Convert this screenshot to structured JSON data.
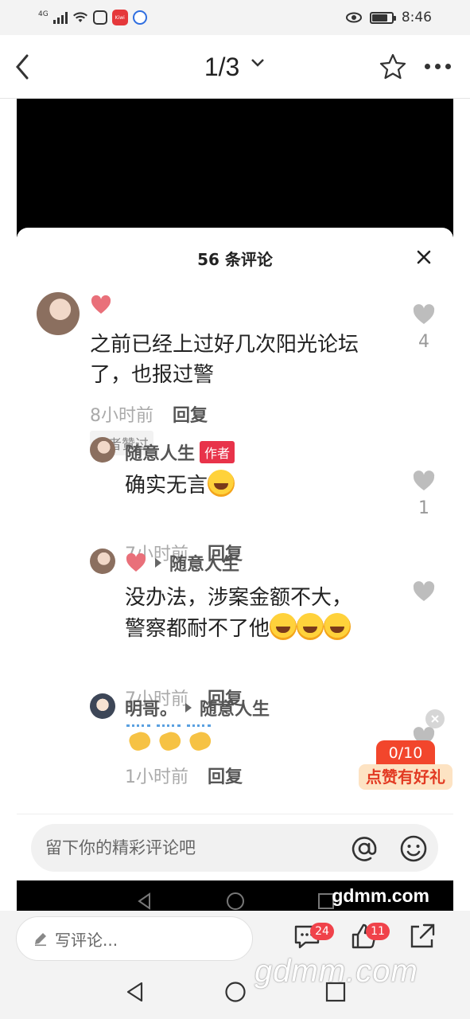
{
  "status_bar": {
    "network": "4G",
    "app_badge": "Kiwi",
    "time": "8:46"
  },
  "nav": {
    "page_indicator": "1/3"
  },
  "comments_sheet": {
    "title": "56 条评论",
    "comments": [
      {
        "author": "",
        "text_line1": "之前已经上过好几次阳光论坛",
        "text_line2": "了，也报过警",
        "time": "8小时前",
        "reply_label": "回复",
        "tag": "作者赞过",
        "likes": "4"
      }
    ],
    "replies": [
      {
        "author": "随意人生",
        "author_tag": "作者",
        "text": "确实无言",
        "time": "7小时前",
        "reply_label": "回复",
        "likes": "1"
      },
      {
        "author_reply_to": "随意人生",
        "text_line1": "没办法，涉案金额不大，",
        "text_line2": "警察都耐不了他",
        "time": "7小时前",
        "reply_label": "回复",
        "likes": ""
      },
      {
        "author": "明哥。",
        "author_reply_to": "随意人生",
        "text": "",
        "time": "1小时前",
        "reply_label": "回复",
        "likes": ""
      }
    ]
  },
  "promo": {
    "count": "0/10",
    "label": "点赞有好礼"
  },
  "comment_input": {
    "placeholder": "留下你的精彩评论吧"
  },
  "watermark": "gdmm.com",
  "bottom_bar": {
    "write_placeholder": "写评论...",
    "comments_badge": "24",
    "likes_badge": "11"
  },
  "bottom_watermark": "gdmm.com",
  "colors": {
    "accent_red": "#e8334a",
    "heart_pink": "#e9707a",
    "promo_orange": "#f2462c"
  }
}
